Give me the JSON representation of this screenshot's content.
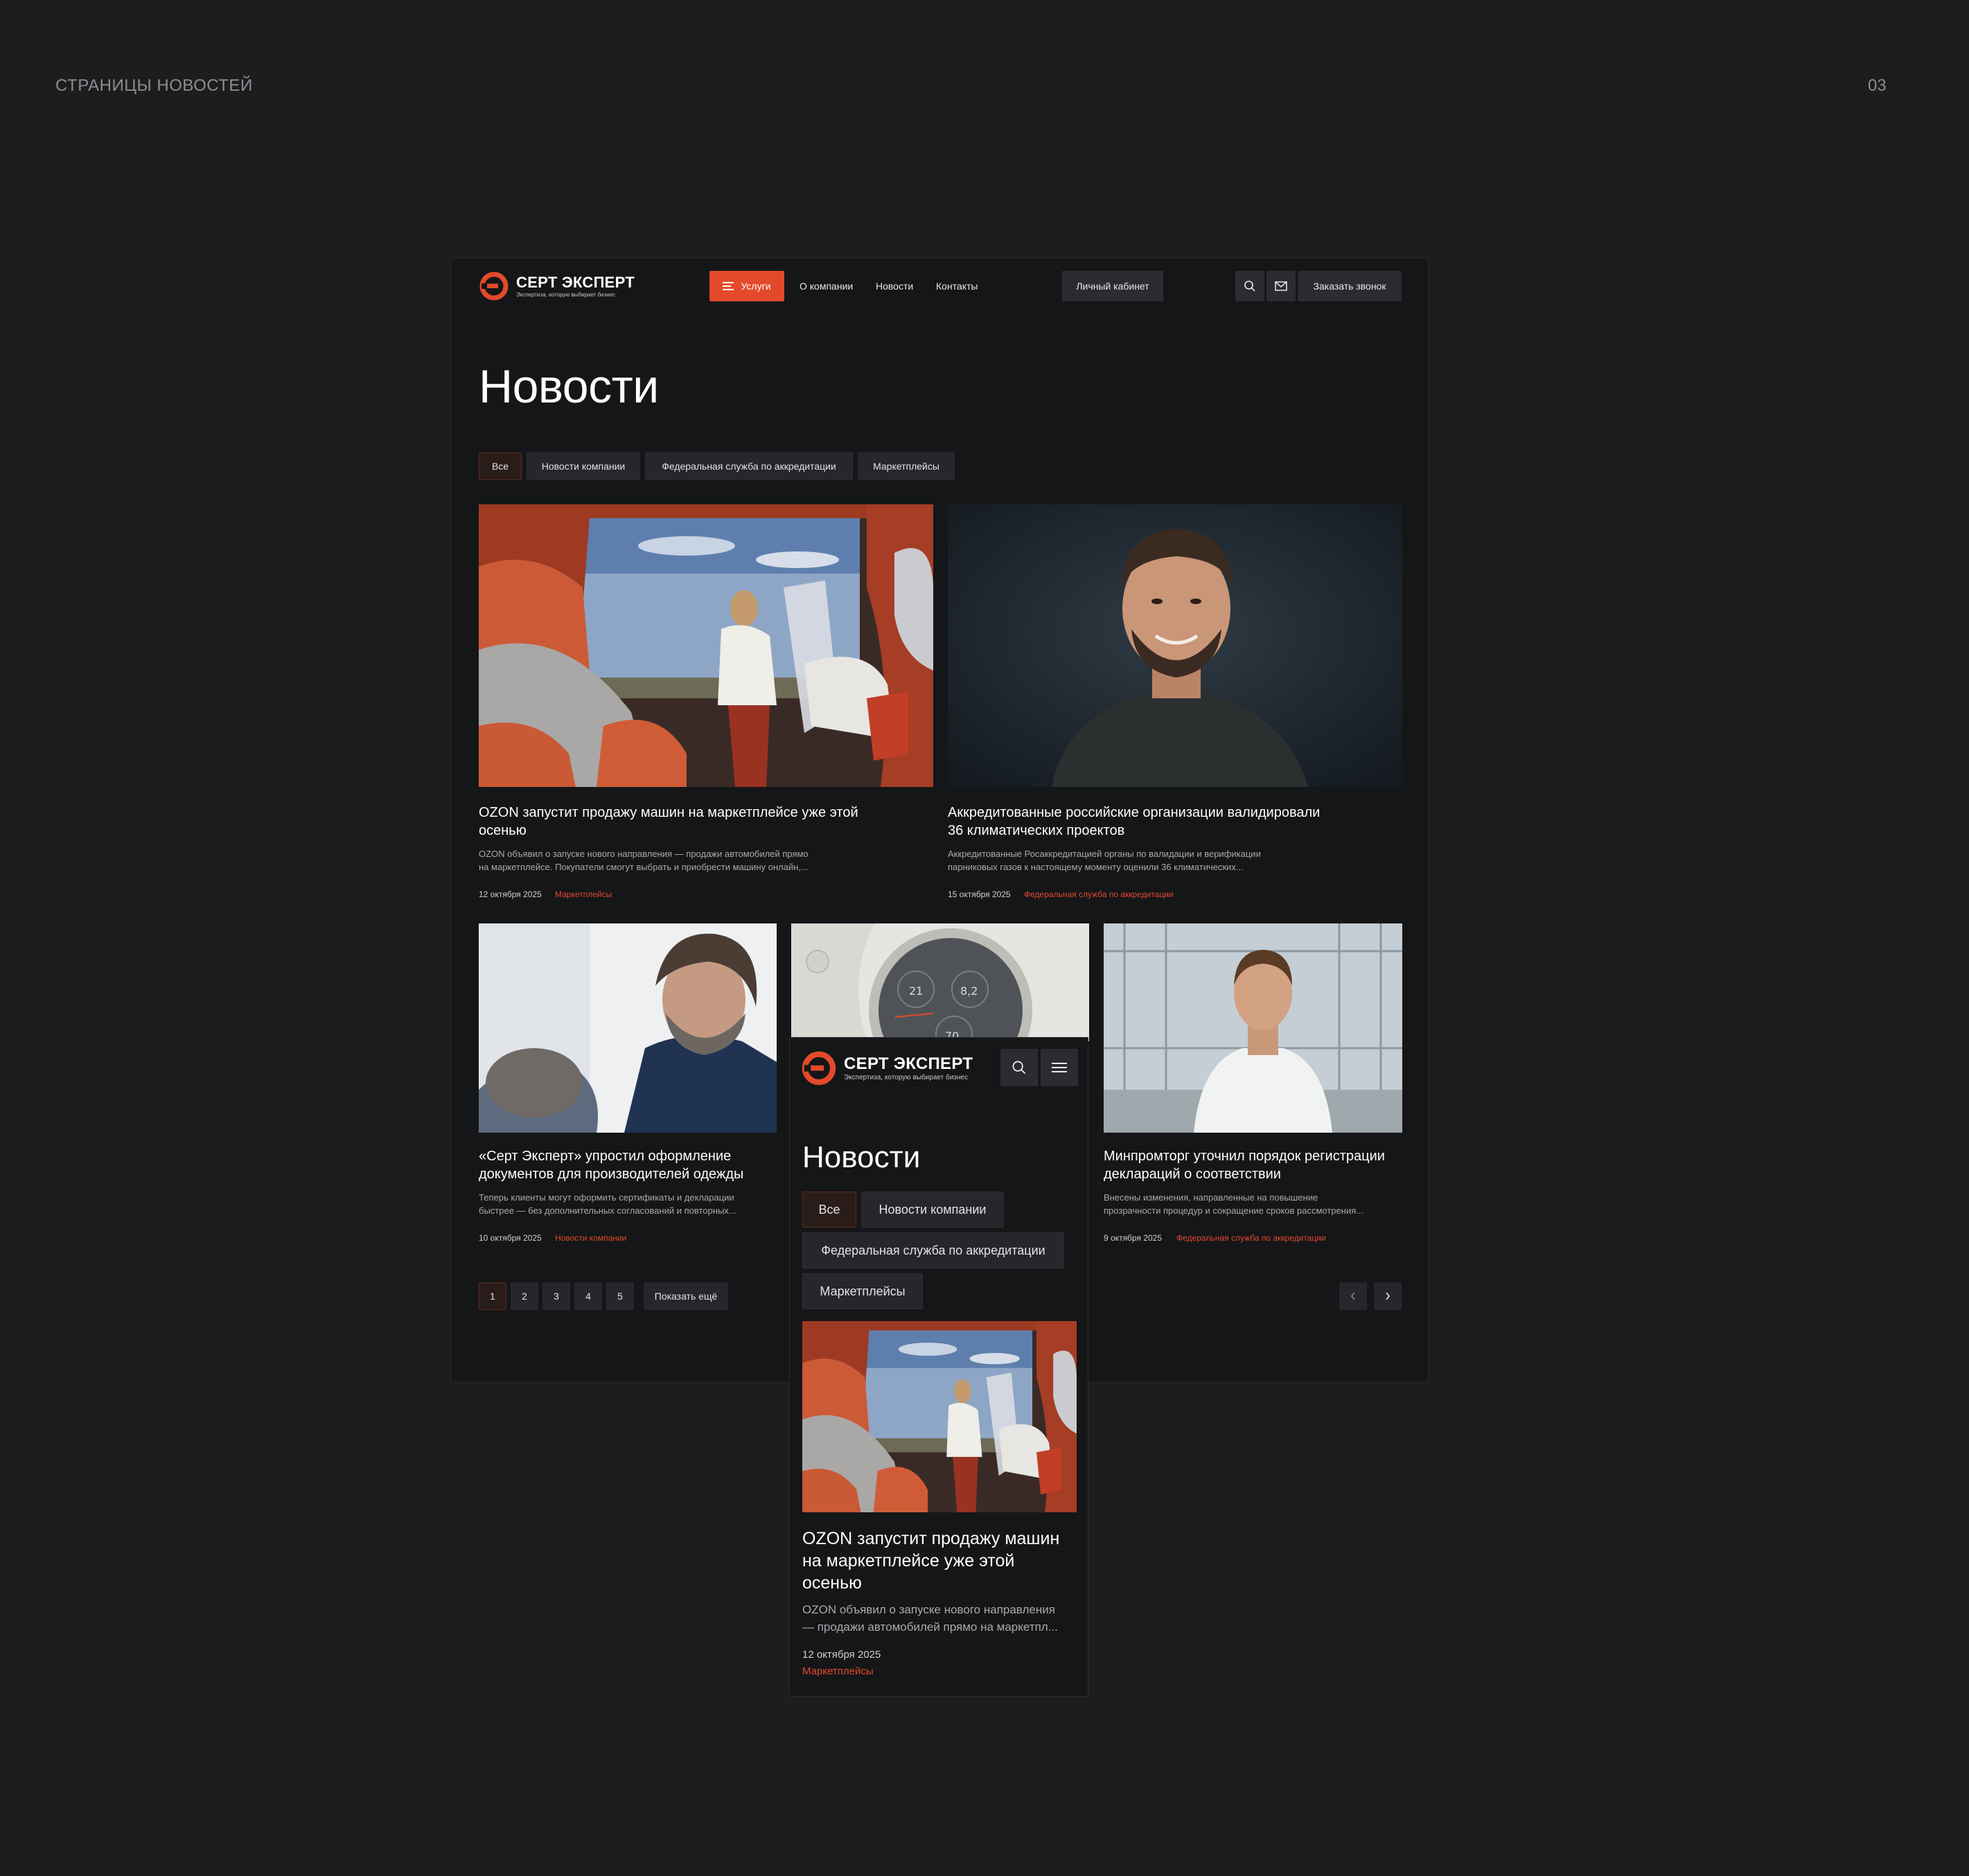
{
  "presentation": {
    "title": "СТРАНИЦЫ НОВОСТЕЙ",
    "page_number": "03"
  },
  "brand": {
    "name": "СЕРТ ЭКСПЕРТ",
    "tagline": "Экспертиза, которую выбирает бизнес",
    "accent": "#e24a2b"
  },
  "header": {
    "services_label": "Услуги",
    "nav": [
      "О компании",
      "Новости",
      "Контакты"
    ],
    "account_label": "Личный кабинет",
    "callback_label": "Заказать звонок",
    "icons": [
      "search-icon",
      "mail-icon",
      "menu-icon"
    ]
  },
  "page_title": "Новости",
  "filters": [
    {
      "label": "Все",
      "active": true
    },
    {
      "label": "Новости компании",
      "active": false
    },
    {
      "label": "Федеральная служба по аккредитации",
      "active": false
    },
    {
      "label": "Маркетплейсы",
      "active": false
    }
  ],
  "news": [
    {
      "title": "OZON запустит продажу машин на маркетплейсе уже этой осенью",
      "excerpt_lines": [
        "OZON объявил о запуске нового направления — продажи автомобилей прямо",
        "на маркетплейсе. Покупатели смогут выбрать и приобрести машину онлайн,..."
      ],
      "date": "12 октября 2025",
      "tag": "Маркетплейсы"
    },
    {
      "title": "Аккредитованные российские организации валидировали 36 климатических проектов",
      "excerpt_lines": [
        "Аккредитованные Росаккредитацией органы по валидации и верификации",
        "парниковых газов к настоящему моменту оценили 36 климатических..."
      ],
      "date": "15 октября 2025",
      "tag": "Федеральная служба по аккредитации"
    },
    {
      "title": "«Серт Эксперт» упростил оформление документов для производителей одежды",
      "excerpt_lines": [
        "Теперь клиенты могут оформить сертификаты и декларации",
        "быстрее — без дополнительных согласований и повторных..."
      ],
      "date": "10 октября 2025",
      "tag": "Новости компании"
    },
    {
      "title": "Минпромторг уточнил порядок регистрации деклараций о соответствии",
      "excerpt_lines": [
        "Внесены изменения, направленные на повышение",
        "прозрачности процедур и сокращение сроков рассмотрения..."
      ],
      "date": "9 октября 2025",
      "tag": "Федеральная служба по аккредитации"
    }
  ],
  "dial_numbers": [
    "21",
    "8,2",
    "70"
  ],
  "pagination": {
    "pages": [
      "1",
      "2",
      "3",
      "4",
      "5"
    ],
    "active_page": "1",
    "show_more_label": "Показать ещё",
    "prev_icon": "chevron-left-icon",
    "next_icon": "chevron-right-icon"
  },
  "mobile": {
    "page_title": "Новости",
    "filters": [
      "Все",
      "Новости компании",
      "Федеральная служба по аккредитации",
      "Маркетплейсы"
    ],
    "card": {
      "title_lines": [
        "OZON запустит продажу машин",
        "на маркетплейсе уже этой",
        "осенью"
      ],
      "excerpt_lines": [
        "OZON объявил о запуске нового направления",
        "— продажи автомобилей прямо на маркетпл..."
      ],
      "date": "12 октября 2025",
      "tag": "Маркетплейсы"
    }
  }
}
